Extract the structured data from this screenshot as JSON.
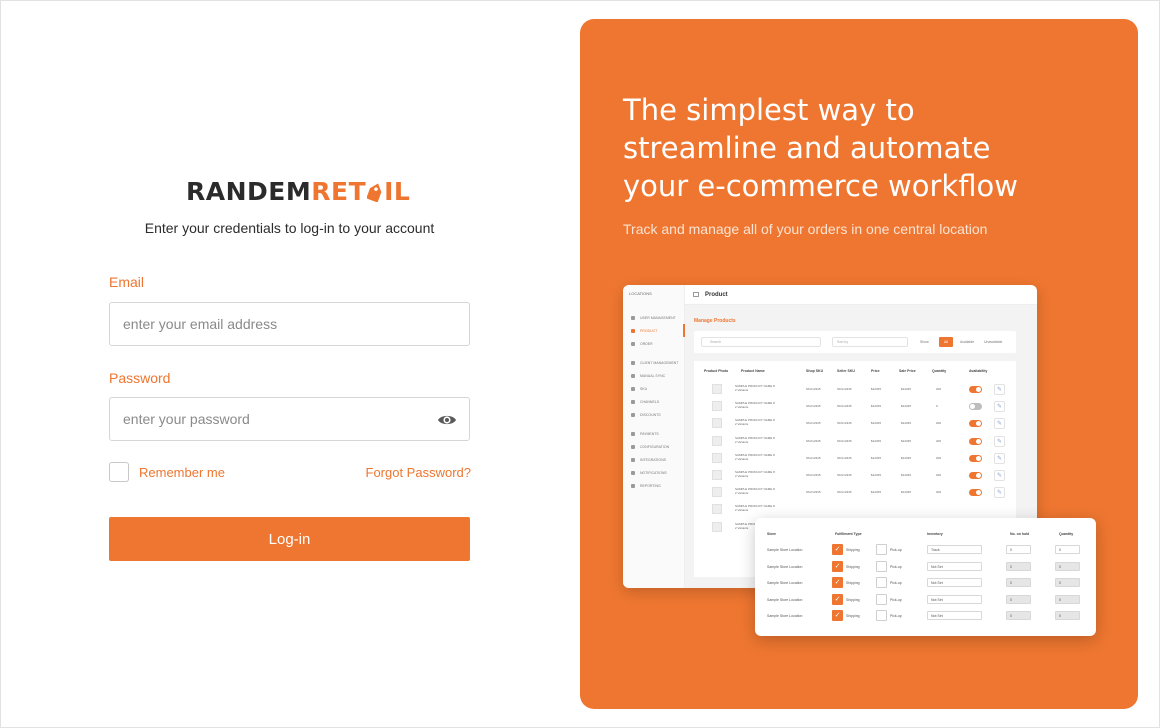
{
  "logo": {
    "part1": "RANDEM",
    "part2": "RET",
    "part3": "IL",
    "brand_dark": "#2b2b2b",
    "brand_orange": "#ee7630"
  },
  "login": {
    "subtitle": "Enter your credentials to log-in to your account",
    "email_label": "Email",
    "email_placeholder": "enter your email address",
    "password_label": "Password",
    "password_placeholder": "enter your password",
    "show_password_icon": "eye-icon",
    "remember_label": "Remember me",
    "forgot_label": "Forgot Password?",
    "submit_label": "Log-in"
  },
  "promo": {
    "headline_line1": "The simplest way to",
    "headline_line2": "streamline and automate",
    "headline_line3": "your e-commerce workflow",
    "tagline": "Track and manage all of your orders in one central location",
    "panel_color": "#ee7630"
  },
  "mock_app": {
    "location_label": "LOCATIONS",
    "title": "Product",
    "subheading": "Manage Products",
    "nav_items": [
      "USER MANAGEMENT",
      "PRODUCT",
      "ORDER",
      "CLIENT MANAGEMENT",
      "MANUAL SYNC",
      "SKU",
      "CHANNELS",
      "DISCOUNTS",
      "PAYMENTS",
      "CONFIGURATION",
      "INTEGRATIONS",
      "NOTIFICATIONS",
      "REPORTING"
    ],
    "search_placeholder": "Search",
    "sort_placeholder": "Sort by",
    "filter_show": "Show",
    "filter_all": "All",
    "filter_available": "Available",
    "filter_unavailable": "Unavailable",
    "columns": [
      "Product Photo",
      "Product Name",
      "Shop SKU",
      "Seller SKU",
      "Price",
      "Sale Price",
      "Quantity",
      "Availability"
    ],
    "rows": [
      {
        "name": "SAMPLE PRODUCT NAME 8",
        "variants": "2 Variants",
        "shop_sku": "SKU12345",
        "seller_sku": "SKU12345",
        "price": "$12345",
        "sale": "$12345",
        "qty": "200",
        "on": true
      },
      {
        "name": "SAMPLE PRODUCT NAME 8",
        "variants": "2 Variants",
        "shop_sku": "SKU12345",
        "seller_sku": "SKU12345",
        "price": "$12345",
        "sale": "$12345",
        "qty": "0",
        "on": false
      },
      {
        "name": "SAMPLE PRODUCT NAME 8",
        "variants": "2 Variants",
        "shop_sku": "SKU12345",
        "seller_sku": "SKU12345",
        "price": "$12345",
        "sale": "$12345",
        "qty": "200",
        "on": true
      },
      {
        "name": "SAMPLE PRODUCT NAME 8",
        "variants": "2 Variants",
        "shop_sku": "SKU12345",
        "seller_sku": "SKU12345",
        "price": "$12345",
        "sale": "$12345",
        "qty": "200",
        "on": true
      },
      {
        "name": "SAMPLE PRODUCT NAME 8",
        "variants": "2 Variants",
        "shop_sku": "SKU12345",
        "seller_sku": "SKU12345",
        "price": "$12345",
        "sale": "$12345",
        "qty": "200",
        "on": true
      },
      {
        "name": "SAMPLE PRODUCT NAME 8",
        "variants": "2 Variants",
        "shop_sku": "SKU12345",
        "seller_sku": "SKU12345",
        "price": "$12345",
        "sale": "$12345",
        "qty": "200",
        "on": true
      },
      {
        "name": "SAMPLE PRODUCT NAME 8",
        "variants": "2 Variants",
        "shop_sku": "SKU12345",
        "seller_sku": "SKU12345",
        "price": "$12345",
        "sale": "$12345",
        "qty": "200",
        "on": true
      },
      {
        "name": "SAMPLE PRODUCT NAME 8",
        "variants": "2 Variants",
        "shop_sku": "",
        "seller_sku": "",
        "price": "",
        "sale": "",
        "qty": "",
        "on": null
      },
      {
        "name": "SAMPLE PRODUCT NAME 8",
        "variants": "2 Variants",
        "shop_sku": "",
        "seller_sku": "",
        "price": "",
        "sale": "",
        "qty": "",
        "on": null
      }
    ]
  },
  "fulfillment": {
    "columns": [
      "Store",
      "Fulfillment Type",
      "Inventory",
      "No. on hold",
      "Quantity"
    ],
    "ship_label": "Shipping",
    "pick_label": "Pick-up",
    "rows": [
      {
        "store": "Sample Store Location",
        "inventory": "Track",
        "hold": "0",
        "qty": "0",
        "disabled": false
      },
      {
        "store": "Sample Store Location",
        "inventory": "Not Set",
        "hold": "0",
        "qty": "0",
        "disabled": true
      },
      {
        "store": "Sample Store Location",
        "inventory": "Not Set",
        "hold": "0",
        "qty": "0",
        "disabled": true
      },
      {
        "store": "Sample Store Location",
        "inventory": "Not Set",
        "hold": "0",
        "qty": "0",
        "disabled": true
      },
      {
        "store": "Sample Store Location",
        "inventory": "Not Set",
        "hold": "0",
        "qty": "0",
        "disabled": true
      }
    ]
  }
}
